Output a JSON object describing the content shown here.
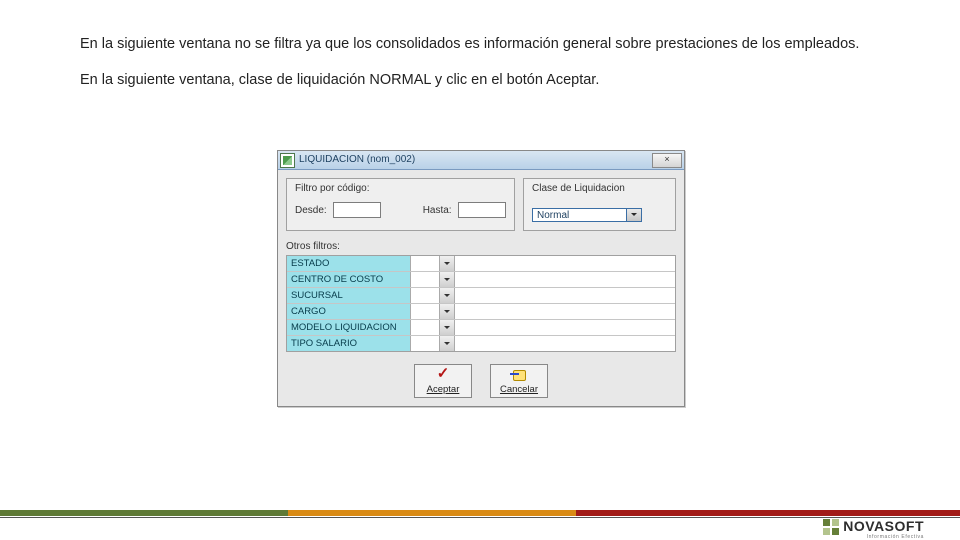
{
  "paragraphs": {
    "p1": "En la siguiente ventana no se filtra ya que los consolidados es información general sobre prestaciones de los empleados.",
    "p2": "En la siguiente ventana, clase de liquidación NORMAL y clic en el botón Aceptar."
  },
  "dialog": {
    "title": "LIQUIDACION (nom_002)",
    "sys_close": "×",
    "group_filter": {
      "legend": "Filtro por código:",
      "desde": "Desde:",
      "hasta": "Hasta:"
    },
    "group_class": {
      "legend": "Clase de Liquidacion",
      "selected": "Normal"
    },
    "other_filters_label": "Otros filtros:",
    "filters": [
      {
        "name": "ESTADO"
      },
      {
        "name": "CENTRO DE COSTO"
      },
      {
        "name": "SUCURSAL"
      },
      {
        "name": "CARGO"
      },
      {
        "name": "MODELO LIQUIDACION"
      },
      {
        "name": "TIPO SALARIO"
      }
    ],
    "buttons": {
      "accept": "Aceptar",
      "cancel": "Cancelar"
    }
  },
  "brand": {
    "name": "NOVASOFT",
    "tagline": "Información Efectiva"
  }
}
